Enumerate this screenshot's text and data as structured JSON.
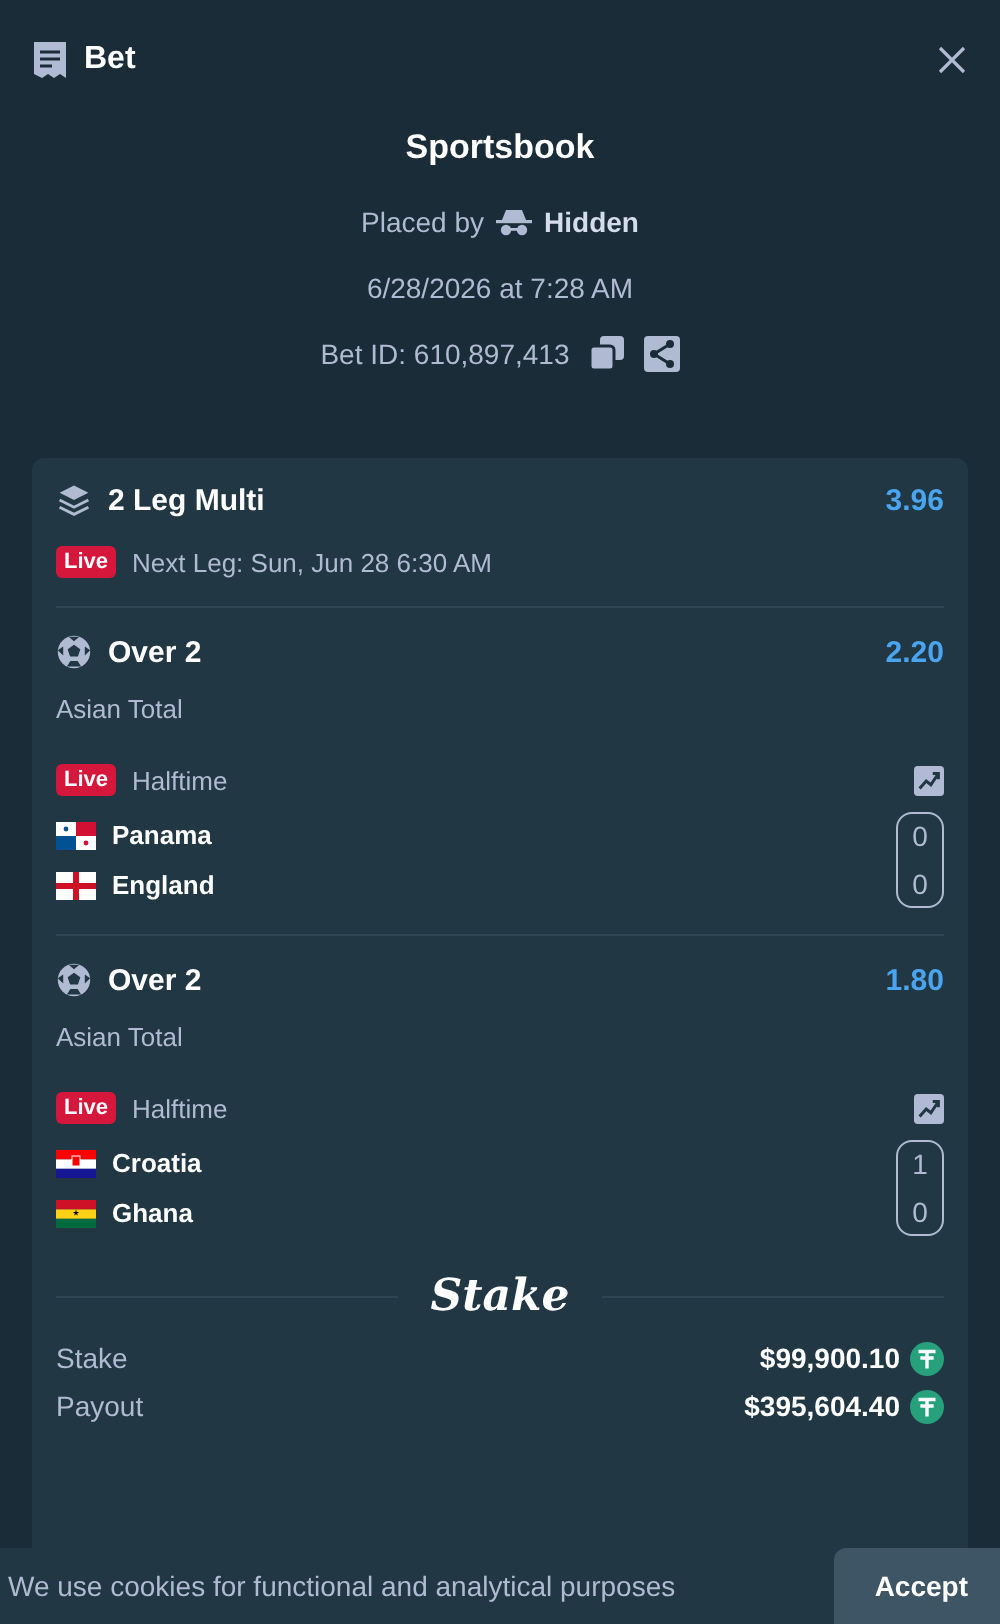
{
  "header": {
    "title": "Bet"
  },
  "summary": {
    "title": "Sportsbook",
    "placed_by": "Placed by",
    "user": "Hidden",
    "date": "6/28/2026 at 7:28 AM",
    "bet_id": "Bet ID: 610,897,413"
  },
  "multi": {
    "title": "2 Leg Multi",
    "odds": "3.96",
    "status": "Live",
    "next_leg": "Next Leg: Sun, Jun 28 6:30 AM"
  },
  "legs": [
    {
      "selection": "Over 2",
      "odds": "2.20",
      "market": "Asian Total",
      "status": "Live",
      "period": "Halftime",
      "teams": [
        {
          "name": "Panama",
          "kind": "panama",
          "score": "0"
        },
        {
          "name": "England",
          "kind": "england",
          "score": "0"
        }
      ]
    },
    {
      "selection": "Over 2",
      "odds": "1.80",
      "market": "Asian Total",
      "status": "Live",
      "period": "Halftime",
      "teams": [
        {
          "name": "Croatia",
          "kind": "croatia",
          "score": "1"
        },
        {
          "name": "Ghana",
          "kind": "ghana",
          "score": "0"
        }
      ]
    }
  ],
  "logo": "Stake",
  "totals": [
    {
      "label": "Stake",
      "amount": "$99,900.10"
    },
    {
      "label": "Payout",
      "amount": "$395,604.40"
    }
  ],
  "cookie": {
    "text": "We use cookies for functional and analytical purposes",
    "button": "Accept"
  }
}
